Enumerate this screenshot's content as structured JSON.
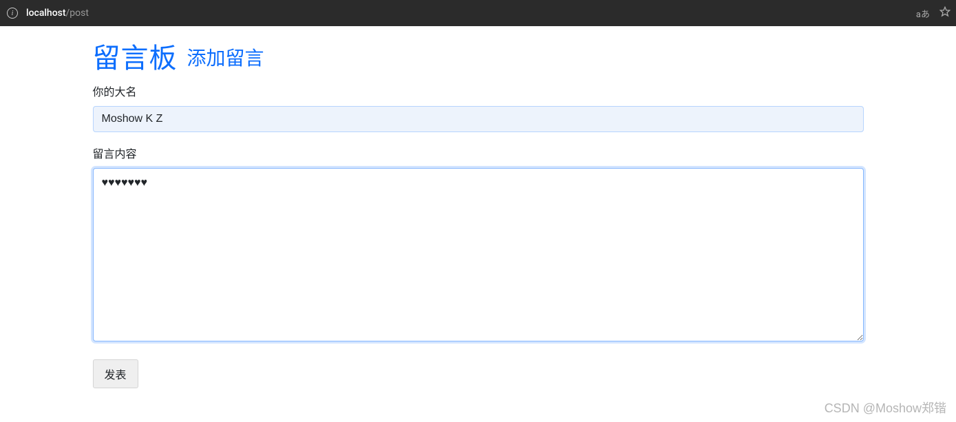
{
  "browser": {
    "url_host": "localhost",
    "url_path": "/post",
    "translate_label": "aあ"
  },
  "page": {
    "title_main": "留言板",
    "title_sub": "添加留言"
  },
  "form": {
    "name_label": "你的大名",
    "name_value": "Moshow K Z",
    "content_label": "留言内容",
    "content_value": "♥♥♥♥♥♥♥",
    "submit_label": "发表"
  },
  "watermark": "CSDN @Moshow郑锴"
}
